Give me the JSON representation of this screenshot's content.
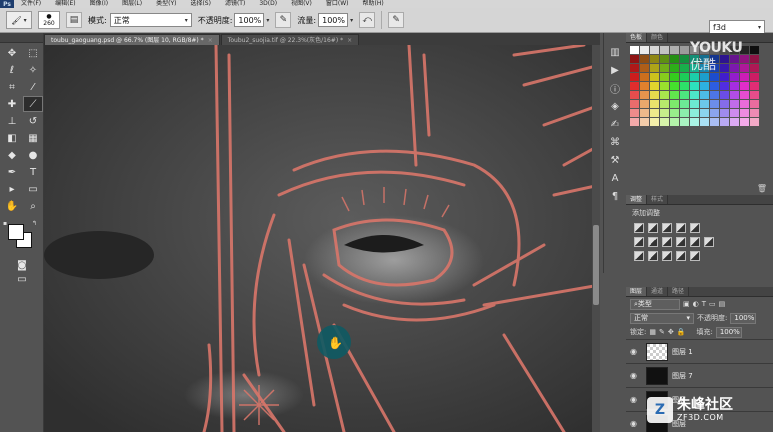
{
  "menu": {
    "logo": "Ps",
    "items": [
      "文件(F)",
      "编辑(E)",
      "图像(I)",
      "图层(L)",
      "类型(Y)",
      "选择(S)",
      "滤镜(T)",
      "3D(D)",
      "视图(V)",
      "窗口(W)",
      "帮助(H)"
    ]
  },
  "options": {
    "brush_size": "260",
    "mode_label": "模式:",
    "mode_value": "正常",
    "opacity_label": "不透明度:",
    "opacity_value": "100%",
    "flow_label": "流量:",
    "flow_value": "100%",
    "workspace_value": "f3d"
  },
  "tabs": [
    {
      "label": "toubu_gaoguang.psd @ 66.7% (图层 10, RGB/8#) *",
      "close": "×"
    },
    {
      "label": "Toubu2_suojia.tif @ 22.3%(灰色/16#) *",
      "close": "×"
    }
  ],
  "panels": {
    "swatch_tabs": [
      "色板",
      "颜色"
    ],
    "adjust_tabs": [
      "调整",
      "样式"
    ],
    "adjust_title": "添加调整",
    "layers_tabs": [
      "图层",
      "通道",
      "路径"
    ],
    "filter_value": "类型",
    "blend_value": "正常",
    "opacity_label": "不透明度:",
    "opacity_value": "100%",
    "lock_label": "锁定:",
    "fill_label": "填充:",
    "fill_value": "100%",
    "layers": [
      {
        "name": "图层 1",
        "thumb": "checker"
      },
      {
        "name": "图层 7",
        "thumb": "drawing"
      },
      {
        "name": "图层",
        "thumb": "drawing"
      },
      {
        "name": "图层",
        "thumb": "drawing"
      }
    ]
  },
  "watermarks": {
    "youku_latin": "YOUKU",
    "youku_cn": "优酷",
    "zf3d_name": "朱峰社区",
    "zf3d_url": "ZF3D.COM",
    "zf3d_logo": "Z"
  },
  "colors": {
    "canvas_bg": "#3b3b3b",
    "stroke_red": "#d9766a",
    "cursor_teal": "#0e5a63"
  },
  "icons": {
    "tools": [
      "move-icon",
      "marquee-icon",
      "lasso-icon",
      "quick-select-icon",
      "crop-icon",
      "eyedropper-icon",
      "healing-icon",
      "brush-icon",
      "stamp-icon",
      "history-brush-icon",
      "eraser-icon",
      "gradient-icon",
      "blur-icon",
      "dodge-icon",
      "pen-icon",
      "type-icon",
      "path-select-icon",
      "shape-icon",
      "hand-icon",
      "zoom-icon"
    ]
  }
}
